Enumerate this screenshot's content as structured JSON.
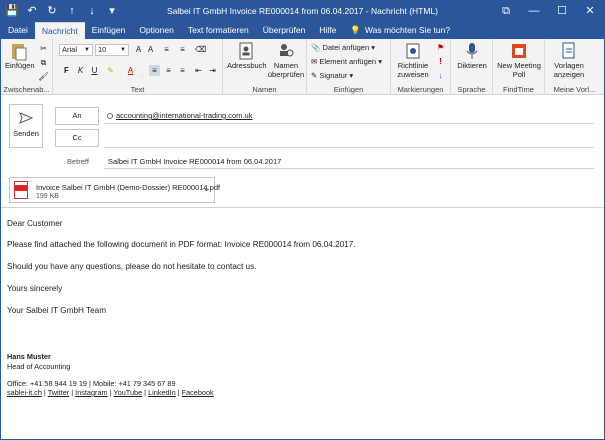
{
  "window": {
    "title": "Salbei IT GmbH Invoice RE000014 from 06.04.2017  -  Nachricht (HTML)",
    "controls": [
      "restore-icon",
      "minimize-icon",
      "maximize-icon",
      "close-icon"
    ]
  },
  "tabs": [
    {
      "label": "Datei"
    },
    {
      "label": "Nachricht",
      "active": true
    },
    {
      "label": "Einfügen"
    },
    {
      "label": "Optionen"
    },
    {
      "label": "Text formatieren"
    },
    {
      "label": "Überprüfen"
    },
    {
      "label": "Hilfe"
    },
    {
      "label": "Was möchten Sie tun?"
    }
  ],
  "ribbon": {
    "clipboard": {
      "paste": "Einfügen",
      "label": "Zwischenab..."
    },
    "text": {
      "font": "Arial",
      "size": "10",
      "label": "Text"
    },
    "names": {
      "addressbook": "Adressbuch",
      "checknames": "Namen überprüfen",
      "label": "Namen"
    },
    "insert": {
      "attach": "Datei anfügen",
      "element": "Element anfügen",
      "signature": "Signatur",
      "label": "Einfügen"
    },
    "tags": {
      "policy": "Richtlinie zuweisen",
      "label": "Markierungen"
    },
    "speech": {
      "dictate": "Diktieren",
      "label": "Sprache"
    },
    "findtime": {
      "meeting": "New Meeting Poll",
      "label": "FindTime"
    },
    "templates": {
      "view": "Vorlagen anzeigen",
      "label": "Meine Vorl..."
    }
  },
  "header": {
    "send": "Senden",
    "to_label": "An",
    "cc_label": "Cc",
    "to_value": "accounting@international-trading.com.uk",
    "subject_label": "Betreff",
    "subject": "Salbei IT GmbH Invoice RE000014 from 06.04.2017"
  },
  "attachment": {
    "name": "Invoice Salbei IT GmbH (Demo-Dossier) RE000014.pdf",
    "size": "199 KB"
  },
  "body": {
    "greeting": "Dear Customer",
    "line1": "Please find attached the following document in PDF format: Invoice RE000014 from 06.04.2017.",
    "line2": "Should you have any questions, please do not hesitate to contact us.",
    "closing": "Yours sincerely",
    "team": "Your Salbei IT GmbH Team"
  },
  "signature": {
    "name": "Hans Muster",
    "role": "Head of Accounting",
    "contact": "Office: +41 58 944 19 19 | Mobile: +41 79 345 67 89",
    "links": [
      "sablei-it.ch",
      "Twitter",
      "Instagram",
      "YouTube",
      "LinkedIn",
      "Facebook"
    ]
  }
}
